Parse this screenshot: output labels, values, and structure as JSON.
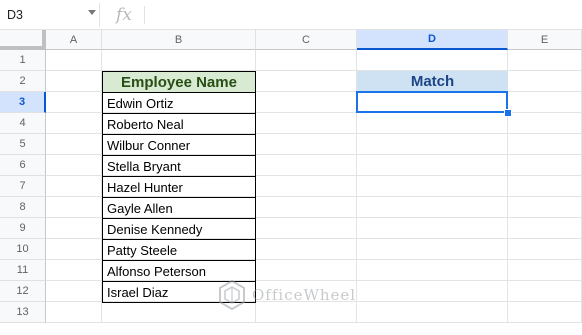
{
  "formula_bar": {
    "name_box": "D3",
    "fx_label": "fx",
    "formula": ""
  },
  "columns": [
    "A",
    "B",
    "C",
    "D",
    "E"
  ],
  "selected_column": "D",
  "rows": [
    "1",
    "2",
    "3",
    "4",
    "5",
    "6",
    "7",
    "8",
    "9",
    "10",
    "11",
    "12",
    "13"
  ],
  "selected_row": "3",
  "table": {
    "header": "Employee Name",
    "names": [
      "Edwin Ortiz",
      "Roberto Neal",
      "Wilbur Conner",
      "Stella Bryant",
      "Hazel Hunter",
      "Gayle Allen",
      "Denise Kennedy",
      "Patty Steele",
      "Alfonso Peterson",
      "Israel Diaz"
    ]
  },
  "match": {
    "header": "Match",
    "value": ""
  },
  "watermark": "OfficeWheel",
  "colors": {
    "employee_header_bg": "#d9ead3",
    "match_header_bg": "#cfe2f3",
    "selection": "#1a73e8"
  }
}
